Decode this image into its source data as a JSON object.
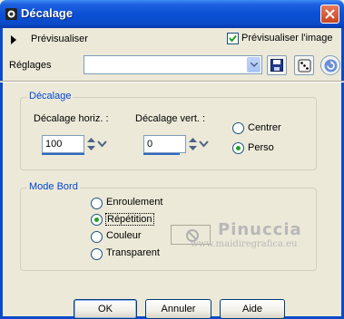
{
  "window": {
    "title": "Décalage",
    "title_icon": "paint-shop-icon",
    "close_icon": "close-icon"
  },
  "toolbar": {
    "preview_toggle_label": "Prévisualiser",
    "preview_image_label": "Prévisualiser l'image",
    "preview_image_checked": true,
    "settings_label": "Réglages",
    "settings_value": "",
    "save_icon": "save-icon",
    "dice_icon": "dice-icon",
    "reset_icon": "reset-icon"
  },
  "offset_group": {
    "legend": "Décalage",
    "horiz_label": "Décalage horiz. :",
    "horiz_value": "100",
    "vert_label": "Décalage vert. :",
    "vert_value": "0",
    "radio_centre_label": "Centrer",
    "radio_perso_label": "Perso",
    "selected": "Perso"
  },
  "edge_mode_group": {
    "legend": "Mode Bord",
    "options": [
      "Enroulement",
      "Répétition",
      "Couleur",
      "Transparent"
    ],
    "selected": "Répétition"
  },
  "watermark": {
    "name": "Pinuccia",
    "url": "www.maidiregrafica.eu"
  },
  "buttons": {
    "ok": "OK",
    "cancel": "Annuler",
    "help": "Aide"
  },
  "colors": {
    "accent": "#0046d5",
    "titlebar": "#0a4fd4",
    "radio_selected": "#21a121"
  }
}
